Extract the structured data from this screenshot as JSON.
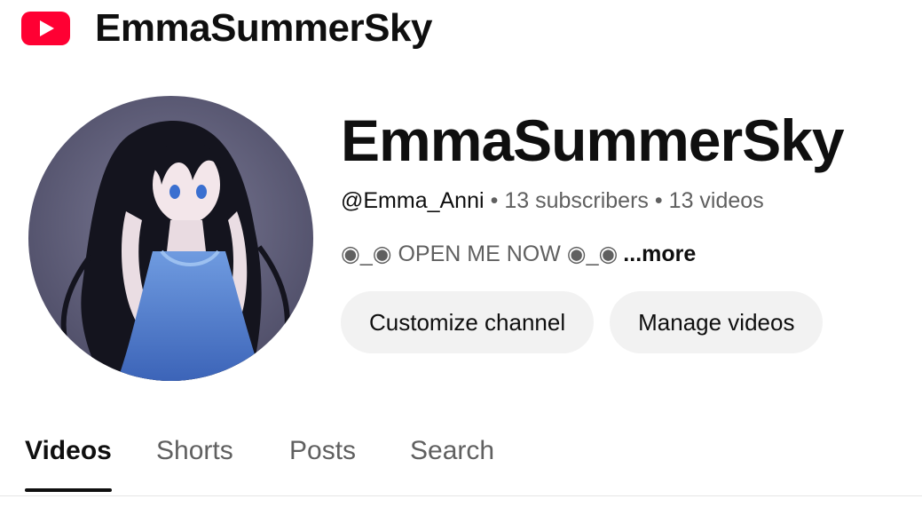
{
  "header": {
    "logo_icon": "youtube-logo-icon",
    "logo_color": "#ff0033",
    "title": "EmmaSummerSky"
  },
  "channel": {
    "avatar_icon": "channel-avatar-anime-girl",
    "name": "EmmaSummerSky",
    "handle": "@Emma_Anni",
    "separator": "•",
    "subscribers": "13 subscribers",
    "videos": "13 videos",
    "description": "◉_◉ OPEN ME NOW ◉_◉",
    "more_label": "...more"
  },
  "actions": {
    "customize_label": "Customize channel",
    "manage_label": "Manage videos"
  },
  "tabs": [
    {
      "label": "Videos",
      "active": true
    },
    {
      "label": "Shorts",
      "active": false
    },
    {
      "label": "Posts",
      "active": false
    },
    {
      "label": "Search",
      "active": false
    }
  ],
  "colors": {
    "text_primary": "#0f0f0f",
    "text_secondary": "#606060",
    "button_bg": "#f2f2f2"
  }
}
